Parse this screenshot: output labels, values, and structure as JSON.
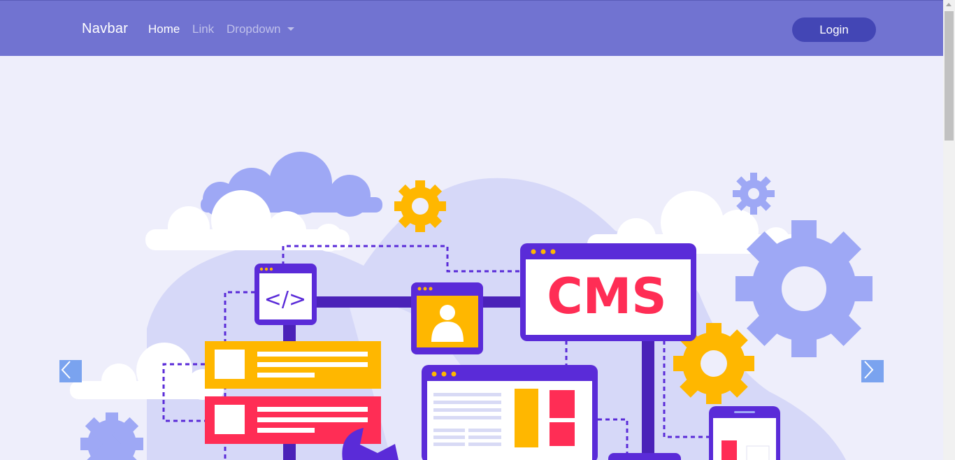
{
  "navbar": {
    "brand": "Navbar",
    "links": [
      "Home",
      "Link",
      "Dropdown"
    ],
    "login_label": "Login"
  },
  "hero": {
    "cms_text": "CMS",
    "code_glyph": "</>"
  },
  "colors": {
    "navbar_bg": "#7173d1",
    "login_bg": "#4346b5",
    "hero_bg": "#eeeefb",
    "purple": "#5a2bd8",
    "yellow": "#ffb700",
    "pink": "#ff2d55",
    "lavender": "#9ea8f5",
    "arrow_bg": "#7aa3ef"
  },
  "icons": {
    "prev": "chevron-left-icon",
    "next": "chevron-right-icon"
  }
}
